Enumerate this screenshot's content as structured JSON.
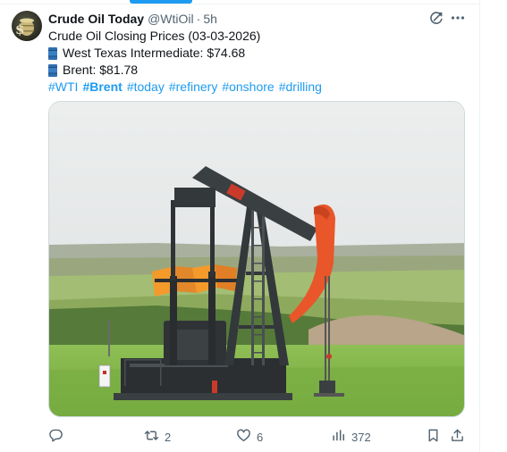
{
  "tweet": {
    "display_name": "Crude Oil Today",
    "handle": "@WtiOil",
    "separator": "·",
    "time": "5h",
    "title_line": "Crude Oil Closing Prices (03-03-2026)",
    "wti_line": "West Texas Intermediate: $74.68",
    "brent_line": "Brent: $81.78",
    "hashtags": [
      "#WTI",
      "#Brent",
      "#today",
      "#refinery",
      "#onshore",
      "#drilling"
    ]
  },
  "metrics": {
    "reposts": "2",
    "likes": "6",
    "views": "372"
  },
  "icons": {
    "avatar": "oil-barrel-dollar-avatar",
    "barrel": "oil-drum-emoji",
    "grok": "grok-icon",
    "more": "more-icon",
    "reply": "reply-icon",
    "repost": "repost-icon",
    "like": "heart-icon",
    "views": "views-icon",
    "bookmark": "bookmark-icon",
    "share": "share-icon"
  },
  "colors": {
    "accent": "#1d9bf0",
    "text": "#0f1419",
    "secondary": "#536471",
    "pump_accent": "#e8562a"
  }
}
